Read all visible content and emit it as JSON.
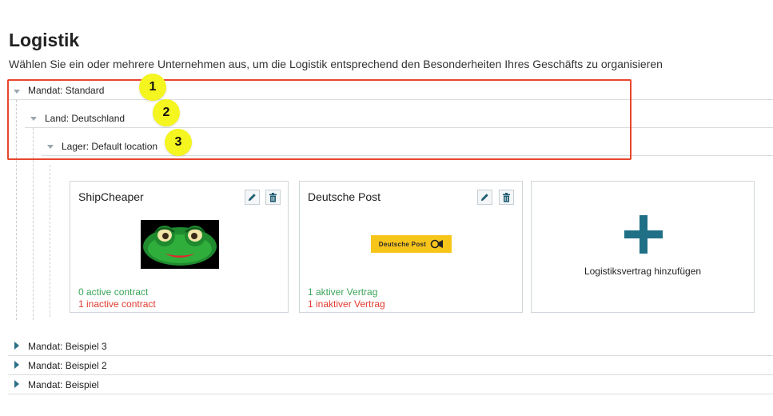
{
  "page": {
    "title": "Logistik",
    "subtitle": "Wählen Sie ein oder mehrere Unternehmen aus, um die Logistik entsprechend den Besonderheiten Ihres Geschäfts zu organisieren"
  },
  "tree": {
    "mandat_standard": "Mandat: Standard",
    "land": "Land: Deutschland",
    "lager": "Lager: Default location",
    "collapsed": [
      "Mandat: Beispiel 3",
      "Mandat: Beispiel 2",
      "Mandat: Beispiel"
    ]
  },
  "badges": [
    "1",
    "2",
    "3"
  ],
  "cards": [
    {
      "title": "ShipCheaper",
      "logo": "frog-logo",
      "active": "0 active contract",
      "inactive": "1 inactive contract"
    },
    {
      "title": "Deutsche Post",
      "logo": "deutsche-post-logo",
      "logo_text": "Deutsche Post",
      "active": "1 aktiver Vertrag",
      "inactive": "1 inaktiver Vertrag"
    }
  ],
  "add_card": {
    "label": "Logistiksvertrag hinzufügen"
  },
  "colors": {
    "accent": "#2a6f86",
    "highlight": "#e8462e",
    "badge": "#f5f51f",
    "active": "#3aa55a",
    "inactive": "#e23b2e"
  }
}
